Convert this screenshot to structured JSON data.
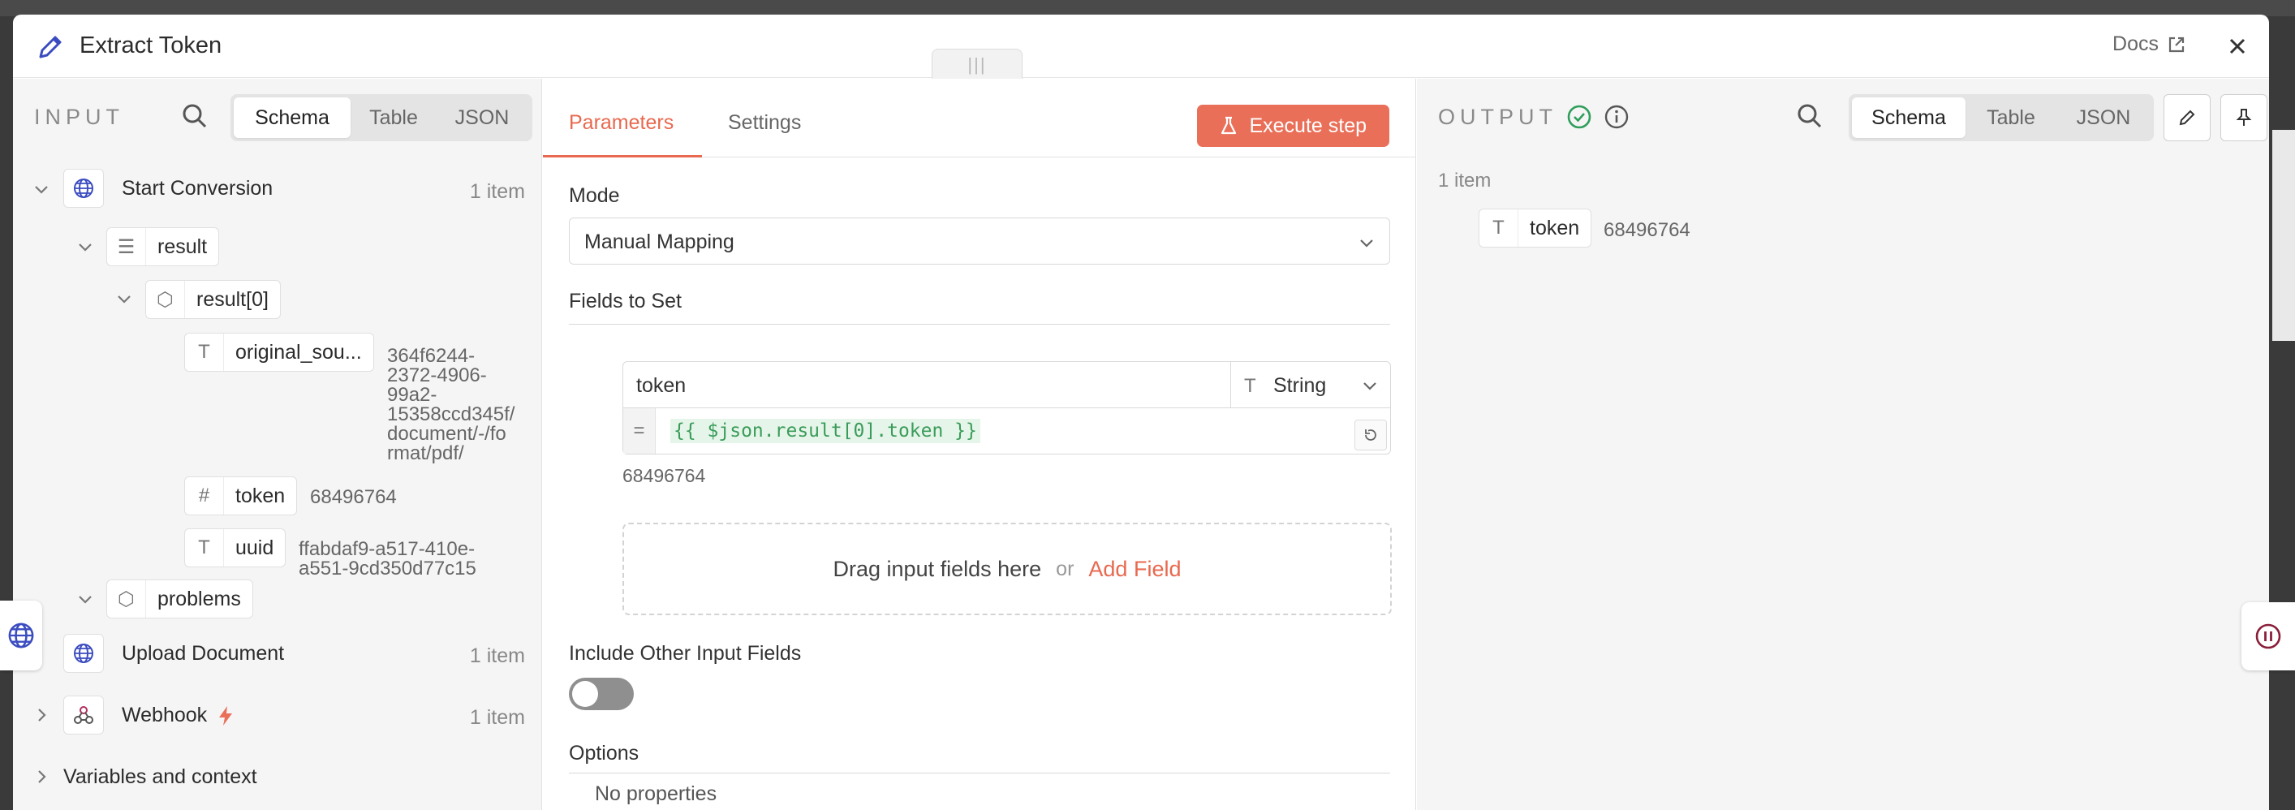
{
  "header": {
    "title": "Extract Token",
    "docs_label": "Docs"
  },
  "input_panel": {
    "label": "INPUT",
    "view_tabs": [
      "Schema",
      "Table",
      "JSON"
    ],
    "active_tab": "Schema",
    "tree": {
      "start_conversion": {
        "label": "Start Conversion",
        "count": "1 item"
      },
      "result": {
        "label": "result"
      },
      "result0": {
        "label": "result[0]"
      },
      "original_source": {
        "label": "original_sou...",
        "value_lines": [
          "364f6244-",
          "2372-4906-",
          "99a2-",
          "15358ccd345f/",
          "document/-/fo",
          "rmat/pdf/"
        ]
      },
      "token": {
        "label": "token",
        "value": "68496764"
      },
      "uuid": {
        "label": "uuid",
        "value_lines": [
          "ffabdaf9-a517-410e-",
          "a551-9cd350d77c15"
        ]
      },
      "problems": {
        "label": "problems"
      },
      "upload_document": {
        "label": "Upload Document",
        "count": "1 item"
      },
      "webhook": {
        "label": "Webhook",
        "count": "1 item"
      },
      "variables": {
        "label": "Variables and context"
      }
    }
  },
  "params_panel": {
    "tabs": [
      "Parameters",
      "Settings"
    ],
    "active_tab": "Parameters",
    "execute_label": "Execute step",
    "mode_label": "Mode",
    "mode_value": "Manual Mapping",
    "fields_title": "Fields to Set",
    "field": {
      "name": "token",
      "type": "String",
      "expression": "{{ $json.result[0].token }}",
      "result": "68496764"
    },
    "dropzone": {
      "text": "Drag input fields here",
      "or": "or",
      "add_label": "Add Field"
    },
    "include_label": "Include Other Input Fields",
    "include_on": false,
    "options_title": "Options",
    "no_properties": "No properties"
  },
  "output_panel": {
    "label": "OUTPUT",
    "view_tabs": [
      "Schema",
      "Table",
      "JSON"
    ],
    "active_tab": "Schema",
    "count": "1 item",
    "field": {
      "label": "token",
      "value": "68496764"
    }
  },
  "colors": {
    "accent": "#e8694f",
    "execute_bg": "#ea6f58",
    "success": "#2e9e5b",
    "icon_blue": "#3b4cc0",
    "pencil_blue": "#3b4cc0"
  },
  "icons": {
    "pencil": "pencil-icon",
    "external_link": "external-link-icon",
    "close": "close-icon",
    "search": "search-icon",
    "globe": "globe-icon",
    "list": "list-icon",
    "cube": "cube-icon",
    "text_type": "text-type-icon",
    "hash": "hash-icon",
    "webhook": "webhook-icon",
    "bolt": "bolt-icon",
    "flask": "flask-icon",
    "reset": "reset-icon",
    "check_circle": "check-circle-icon",
    "info": "info-icon",
    "edit": "edit-icon",
    "pin": "pin-icon",
    "pause": "pause-icon"
  }
}
